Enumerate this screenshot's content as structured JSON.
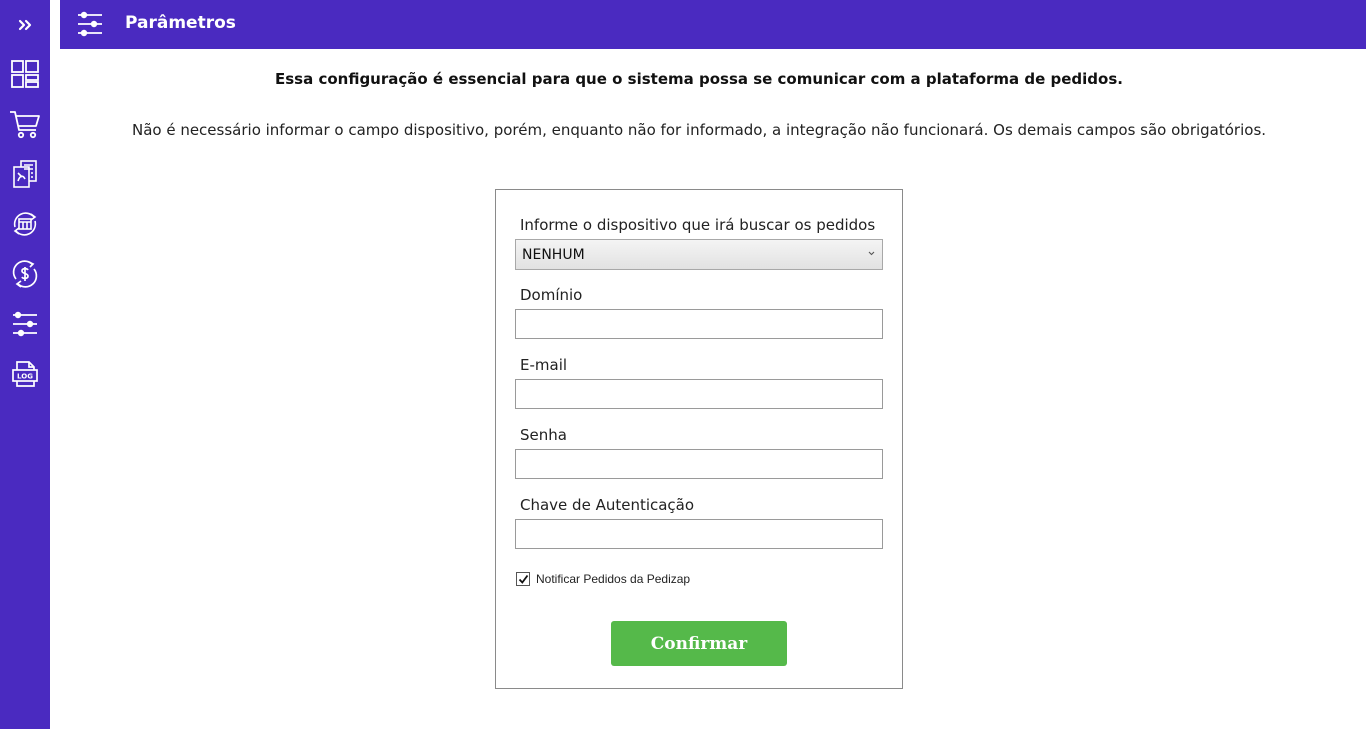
{
  "sidebar": {
    "items": [
      {
        "icon": "chevrons-right-icon",
        "label": "expand"
      },
      {
        "icon": "dashboard-icon",
        "label": "dashboard"
      },
      {
        "icon": "cart-icon",
        "label": "pedidos"
      },
      {
        "icon": "documents-icon",
        "label": "documentos"
      },
      {
        "icon": "sync-store-icon",
        "label": "sincronizar"
      },
      {
        "icon": "dollar-sync-icon",
        "label": "financeiro"
      },
      {
        "icon": "sliders-icon",
        "label": "parametros"
      },
      {
        "icon": "log-file-icon",
        "label": "log"
      }
    ],
    "color": "#4a2ac0"
  },
  "header": {
    "title": "Parâmetros",
    "icon": "sliders-icon",
    "color": "#4a2ac0"
  },
  "intro": {
    "bold": "Essa configuração é essencial para que o sistema possa se comunicar com a plataforma de pedidos.",
    "normal": "Não é necessário informar o campo dispositivo, porém, enquanto não for informado, a integração não funcionará. Os demais campos são obrigatórios."
  },
  "form": {
    "device_label": "Informe o dispositivo que irá buscar os pedidos",
    "device_value": "NENHUM",
    "domain_label": "Domínio",
    "domain_value": "",
    "email_label": "E-mail",
    "email_value": "",
    "password_label": "Senha",
    "password_value": "",
    "auth_key_label": "Chave de Autenticação",
    "auth_key_value": "",
    "notify_label": "Notificar Pedidos da Pedizap",
    "notify_checked": true,
    "confirm_label": "Confirmar",
    "confirm_color": "#55b94a"
  }
}
